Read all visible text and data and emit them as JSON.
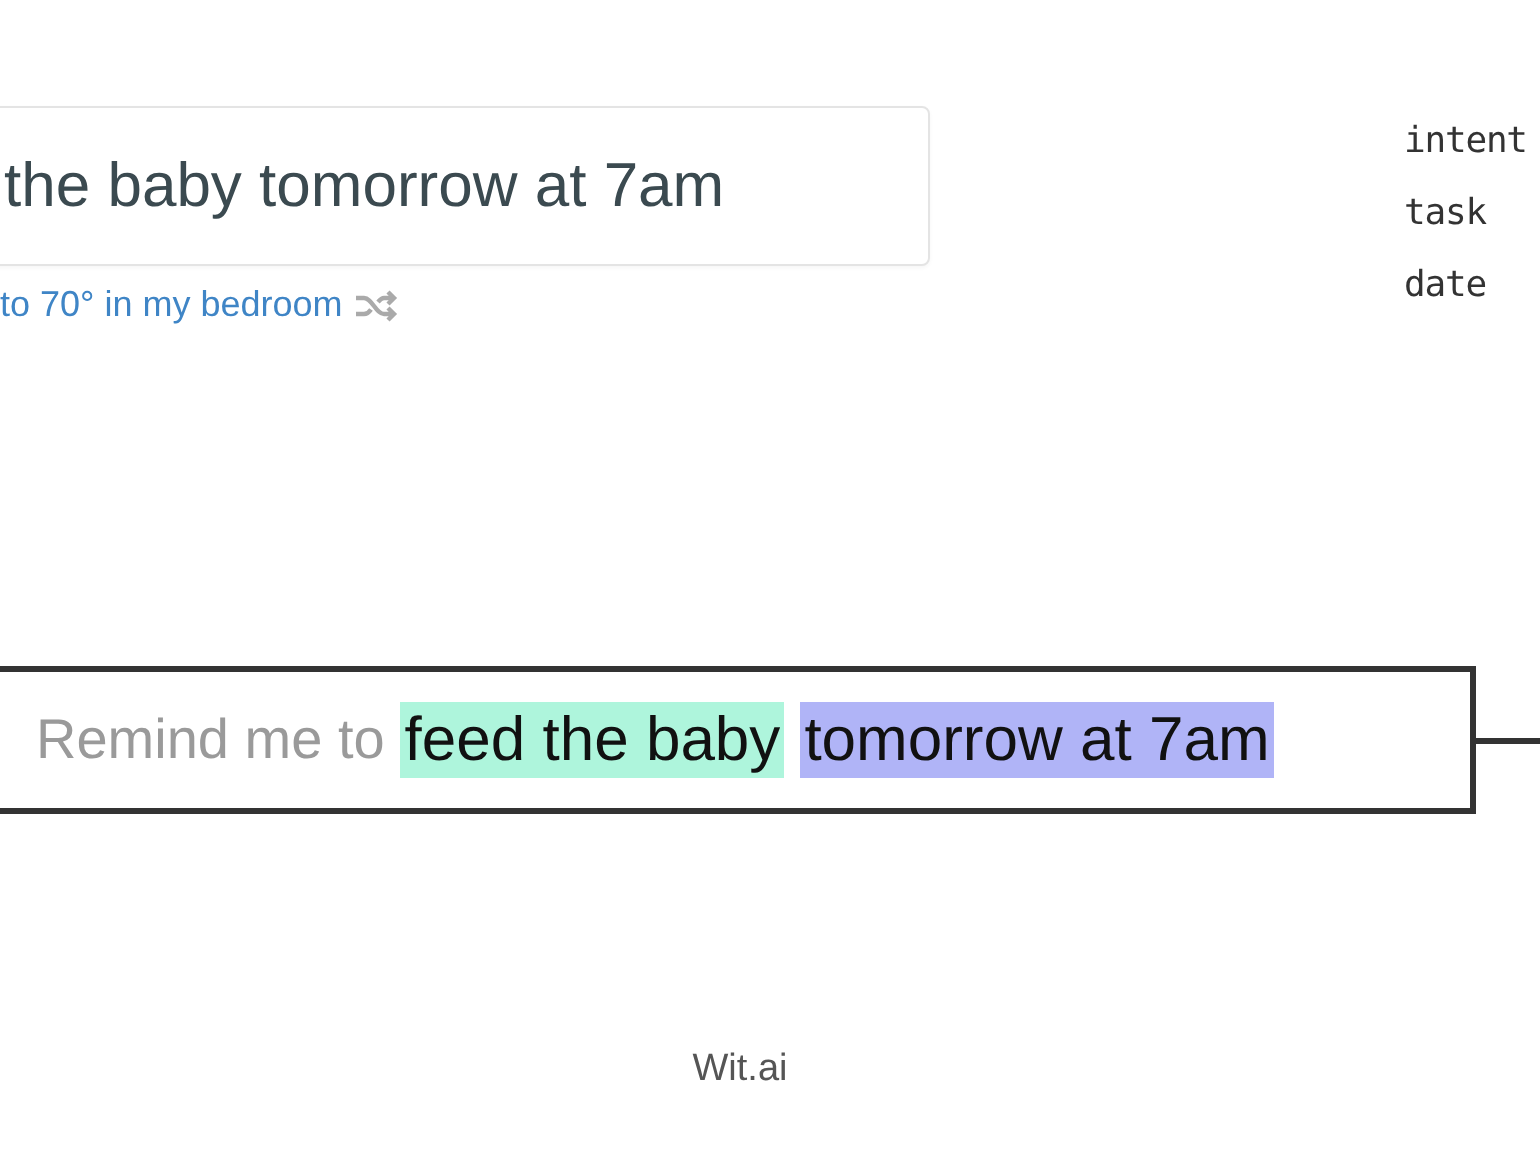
{
  "query_field": {
    "value": "the baby tomorrow at 7am"
  },
  "suggestion": {
    "text": "to 70° in my bedroom"
  },
  "entity_labels": [
    "intent",
    "task",
    "date"
  ],
  "parsed_sentence": [
    {
      "text": "Remind me to",
      "kind": "plain"
    },
    {
      "text": "feed the baby",
      "kind": "entity",
      "color": "#aef5dc"
    },
    {
      "text": "tomorrow at 7am",
      "kind": "entity",
      "color": "#b0b4f7"
    }
  ],
  "footer": {
    "brand": "Wit.ai"
  }
}
